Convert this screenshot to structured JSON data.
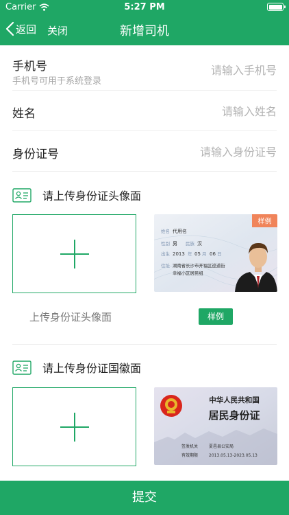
{
  "status_bar": {
    "carrier": "Carrier",
    "time": "5:27 PM"
  },
  "nav": {
    "back_label": "返回",
    "close_label": "关闭",
    "title": "新增司机"
  },
  "form": {
    "phone": {
      "label": "手机号",
      "hint": "手机号可用于系统登录",
      "placeholder": "请输入手机号"
    },
    "name": {
      "label": "姓名",
      "placeholder": "请输入姓名"
    },
    "id_number": {
      "label": "身份证号",
      "placeholder": "请输入身份证号"
    }
  },
  "id_front": {
    "title": "请上传身份证头像面",
    "caption": "上传身份证头像面",
    "sample_button": "样例",
    "sample_card": {
      "tag": "样例",
      "name_label": "姓名",
      "name_value": "代用名",
      "sex_label": "性别",
      "sex_value": "男",
      "ethnicity_label": "民族",
      "ethnicity_value": "汉",
      "birth_label": "出生",
      "birth_year": "2013",
      "birth_year_unit": "年",
      "birth_month": "05",
      "birth_month_unit": "月",
      "birth_day": "06",
      "birth_day_unit": "日",
      "address_label": "住址",
      "address_line1": "湖南省长沙市开福区巡道街",
      "address_line2": "幸福小区居民组"
    }
  },
  "id_back": {
    "title": "请上传身份证国徽面",
    "sample_card": {
      "country": "中华人民共和国",
      "card_title": "居民身份证",
      "issuer_label": "签发机关",
      "issuer_value": "夏邑县公安局",
      "validity_label": "有效期限",
      "validity_value": "2013.05.13-2023.05.13"
    }
  },
  "submit_label": "提交",
  "colors": {
    "brand": "#1fa765",
    "sample_tag": "#f0845a",
    "emblem_red": "#d9261c"
  }
}
